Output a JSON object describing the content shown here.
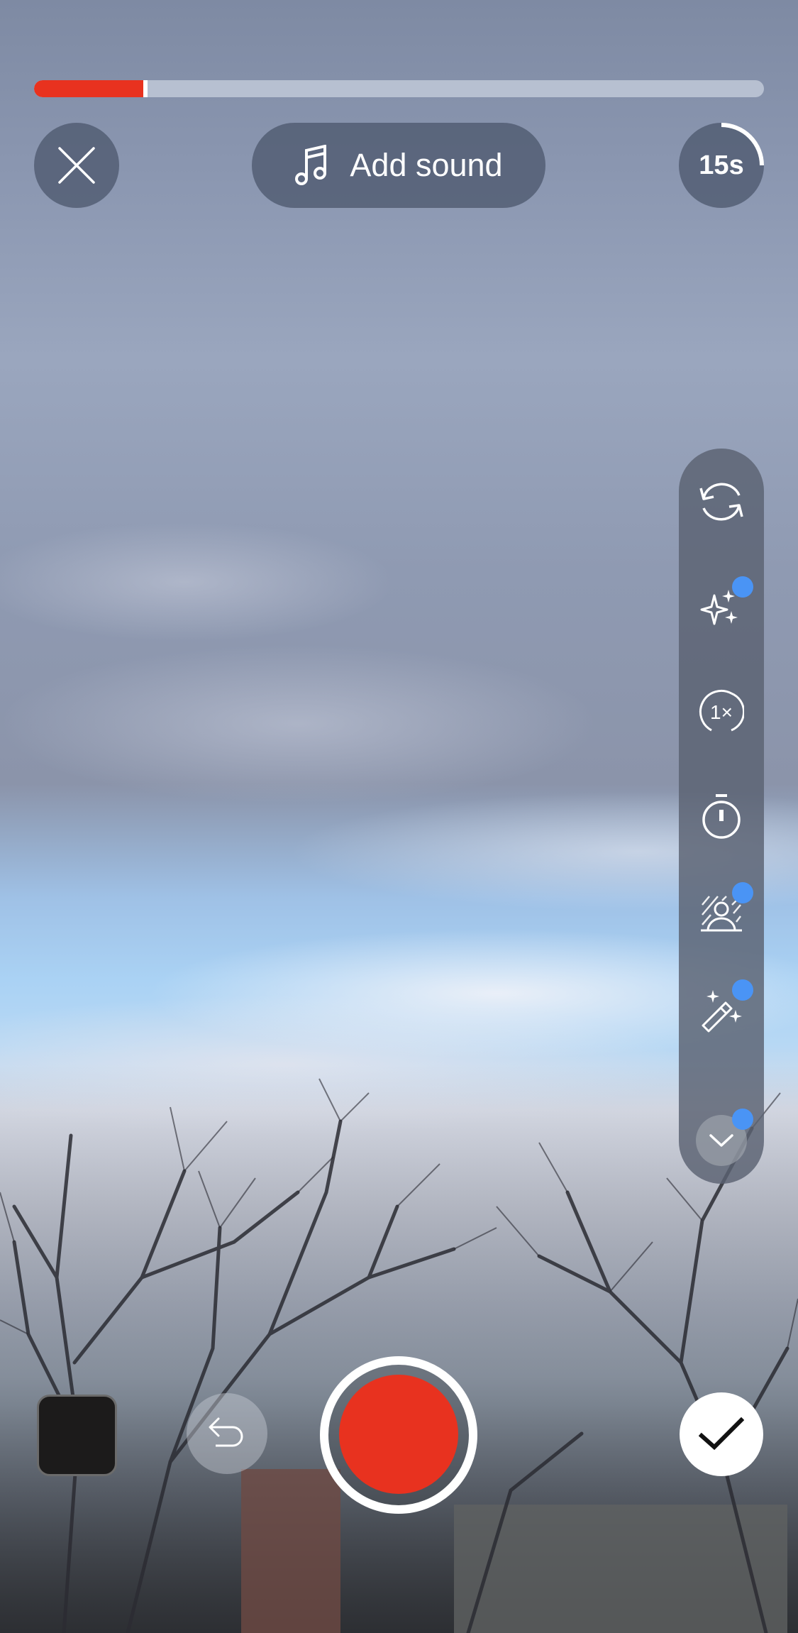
{
  "recording": {
    "progress_fraction": 0.15,
    "progress_color": "#e8321f"
  },
  "top_bar": {
    "close_icon": "close-icon",
    "add_sound": {
      "icon": "music-note-icon",
      "label": "Add sound"
    },
    "duration": {
      "label": "15s",
      "arc_fraction": 0.25
    }
  },
  "sidebar": {
    "items": [
      {
        "name": "flip-camera",
        "icon": "flip-camera-icon",
        "badge": false
      },
      {
        "name": "beauty",
        "icon": "sparkles-icon",
        "badge": true
      },
      {
        "name": "speed",
        "icon": "speed-1x-icon",
        "label": "1×",
        "badge": false
      },
      {
        "name": "timer",
        "icon": "timer-icon",
        "badge": false
      },
      {
        "name": "green-screen",
        "icon": "green-screen-icon",
        "badge": true
      },
      {
        "name": "effects",
        "icon": "magic-wand-icon",
        "badge": true
      },
      {
        "name": "more",
        "icon": "chevron-down-icon",
        "badge": true
      }
    ],
    "badge_color": "#4a94f5"
  },
  "bottom_bar": {
    "gallery_icon": "gallery-thumbnail",
    "undo_icon": "undo-icon",
    "record_icon": "record-button",
    "confirm_icon": "checkmark-icon"
  }
}
